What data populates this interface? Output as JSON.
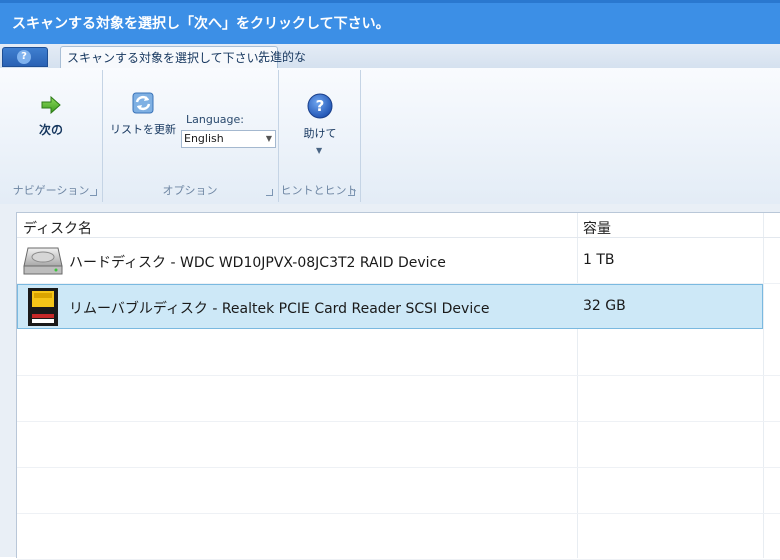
{
  "window": {
    "title": "スキャンする対象を選択し「次へ」をクリックして下さい。"
  },
  "tabs": [
    {
      "label": "スキャンする対象を選択して下さい。",
      "active": true
    },
    {
      "label": "先進的な",
      "active": false
    }
  ],
  "ribbon": {
    "navigation": {
      "next_label": "次の",
      "group_label": "ナビゲーション"
    },
    "options": {
      "refresh_label": "リストを更新",
      "language_label": "Language:",
      "language_value": "English",
      "group_label": "オプション"
    },
    "hints": {
      "help_label": "助けて",
      "group_label": "ヒントとヒント"
    }
  },
  "list": {
    "columns": [
      "ディスク名",
      "容量"
    ],
    "rows": [
      {
        "name": "ハードディスク - WDC WD10JPVX-08JC3T2 RAID Device",
        "capacity": "1 TB",
        "icon": "hard-disk-icon",
        "selected": false
      },
      {
        "name": "リムーバブルディスク - Realtek PCIE Card Reader SCSI Device",
        "capacity": "32 GB",
        "icon": "sd-card-icon",
        "selected": true
      }
    ]
  },
  "colors": {
    "titlebar": "#3c8fe6",
    "selection": "#cde8f7"
  }
}
